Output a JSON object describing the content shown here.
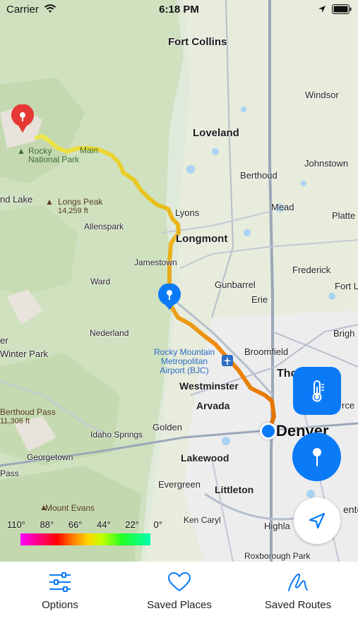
{
  "status_bar": {
    "carrier": "Carrier",
    "time": "6:18 PM"
  },
  "map": {
    "cities": {
      "fort_collins": "Fort Collins",
      "windsor": "Windsor",
      "loveland": "Loveland",
      "berthoud": "Berthoud",
      "johnstown": "Johnstown",
      "mead": "Mead",
      "platteville": "Platte",
      "lyons": "Lyons",
      "longmont": "Longmont",
      "frederick": "Frederick",
      "fort_lupton": "Fort L",
      "jamestown": "Jamestown",
      "gunbarrel": "Gunbarrel",
      "erie": "Erie",
      "ward": "Ward",
      "brighton": "Brigh",
      "nederland": "Nederland",
      "broomfield": "Broomfield",
      "winter_park": "Winter Park",
      "westminster": "Westminster",
      "thornton": "Tho",
      "arvada": "Arvada",
      "commerce_city": "rce",
      "golden": "Golden",
      "denver": "Denver",
      "idaho_springs": "Idaho Springs",
      "georgetown": "Georgetown",
      "lakewood": "Lakewood",
      "evergreen": "Evergreen",
      "littleton": "Littleton",
      "centennial": "ente",
      "ken_caryl": "Ken Caryl",
      "highlands_ranch": "Highla",
      "roxborough_park": "Roxborough Park",
      "grand_lake": "nd Lake",
      "allenspark": "Allenspark",
      "er": "er",
      "pass": "Pass"
    },
    "poi": {
      "rocky_mountain_np_line1": "Rocky",
      "rocky_mountain_np_line2": "National Park",
      "rocky_mountain_np_fragment": "Main",
      "longs_peak": "Longs Peak",
      "longs_peak_elev": "14,259 ft",
      "berthoud_pass": "Berthoud Pass",
      "berthoud_pass_elev": "11,306 ft",
      "mount_evans": "Mount Evans",
      "airport_line1": "Rocky Mountain",
      "airport_line2": "Metropolitan",
      "airport_line3": "Airport (BJC)"
    }
  },
  "temperature_scale": {
    "labels": [
      "110°",
      "88°",
      "66°",
      "44°",
      "22°",
      "0°"
    ]
  },
  "buttons": {
    "thermometer": "thermometer-icon",
    "pin": "pin-icon",
    "locate": "location-arrow-icon"
  },
  "tab_bar": {
    "options": "Options",
    "saved_places": "Saved Places",
    "saved_routes": "Saved Routes"
  },
  "colors": {
    "accent": "#0a7af7",
    "route_hot": "#e37400",
    "route_mild": "#e6d020",
    "pin_red": "#e53935"
  }
}
